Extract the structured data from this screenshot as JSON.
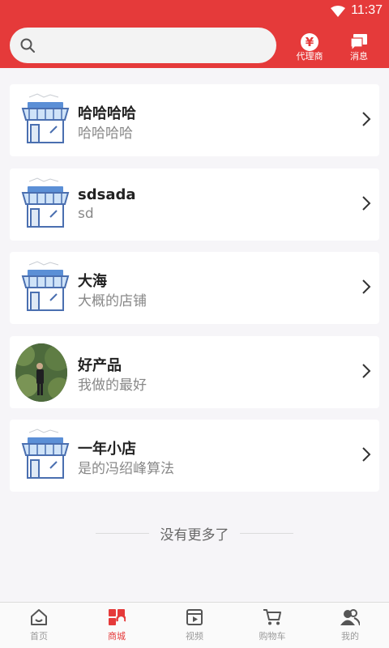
{
  "status_bar": {
    "time": "11:37"
  },
  "search": {
    "placeholder": ""
  },
  "header_buttons": {
    "agent_label": "代理商",
    "message_label": "消息"
  },
  "shops": [
    {
      "name": "哈哈哈哈",
      "description": "哈哈哈哈",
      "avatar": "shop-icon"
    },
    {
      "name": "sdsada",
      "description": "sd",
      "avatar": "shop-icon"
    },
    {
      "name": "大海",
      "description": "大概的店铺",
      "avatar": "shop-icon"
    },
    {
      "name": "好产品",
      "description": "我做的最好",
      "avatar": "person-photo"
    },
    {
      "name": "一年小店",
      "description": "是的冯绍峰算法",
      "avatar": "shop-icon"
    }
  ],
  "footer_text": "没有更多了",
  "nav": [
    {
      "label": "首页",
      "icon": "home-icon",
      "active": false
    },
    {
      "label": "商城",
      "icon": "mall-icon",
      "active": true
    },
    {
      "label": "视频",
      "icon": "video-icon",
      "active": false
    },
    {
      "label": "购物车",
      "icon": "cart-icon",
      "active": false
    },
    {
      "label": "我的",
      "icon": "profile-icon",
      "active": false
    }
  ],
  "colors": {
    "brand": "#e53a3a",
    "background": "#f6f5f8",
    "nav_inactive": "#9a9a9a"
  }
}
